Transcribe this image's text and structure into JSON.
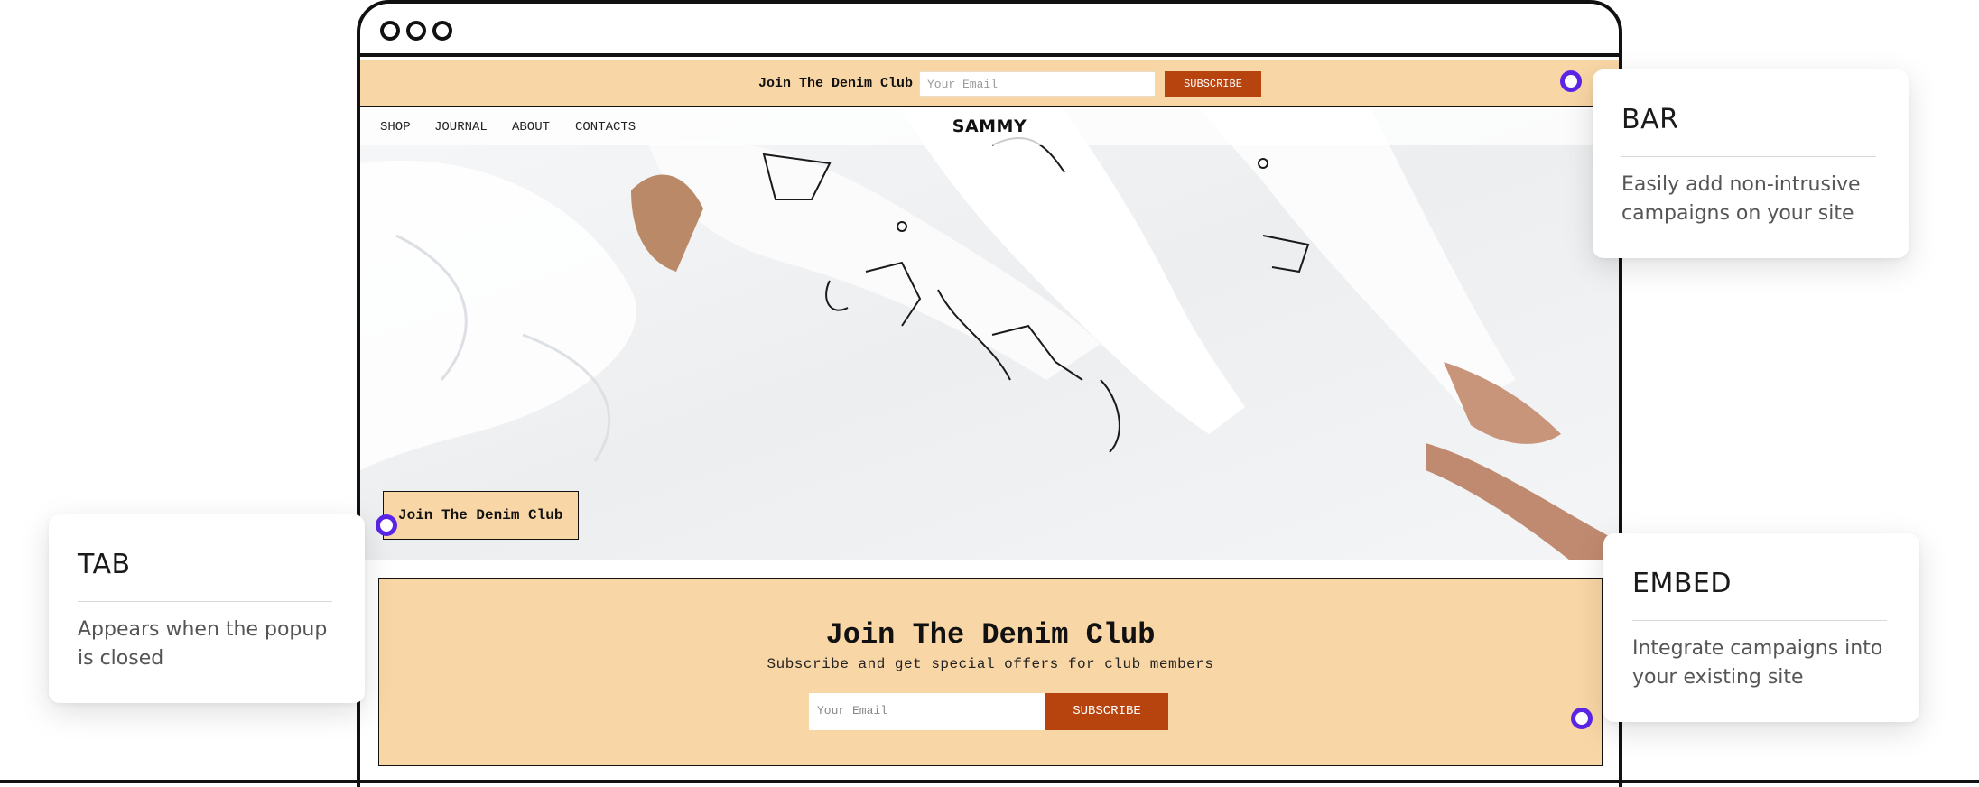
{
  "top_bar": {
    "title": "Join The Denim Club",
    "email_placeholder": "Your Email",
    "subscribe_label": "SUBSCRIBE"
  },
  "site": {
    "brand": "SAMMY",
    "nav": [
      "SHOP",
      "JOURNAL",
      "ABOUT",
      "CONTACTS"
    ]
  },
  "tab": {
    "label": "Join The Denim Club"
  },
  "embed": {
    "title": "Join The Denim Club",
    "subtitle": "Subscribe and get special offers for club members",
    "email_placeholder": "Your Email",
    "subscribe_label": "SUBSCRIBE"
  },
  "callouts": {
    "bar": {
      "title": "BAR",
      "description_lines": [
        "Easily add non-intrusive",
        "campaigns on your site"
      ]
    },
    "tab": {
      "title": "TAB",
      "description_lines": [
        "Appears when the popup",
        "is closed"
      ]
    },
    "embed": {
      "title": "EMBED",
      "description_lines": [
        "Integrate campaigns into",
        "your existing site"
      ]
    }
  },
  "colors": {
    "campaign_bg": "#f9d6a5",
    "button": "#b7430e",
    "indicator": "#5b25e6",
    "frame": "#111111"
  }
}
